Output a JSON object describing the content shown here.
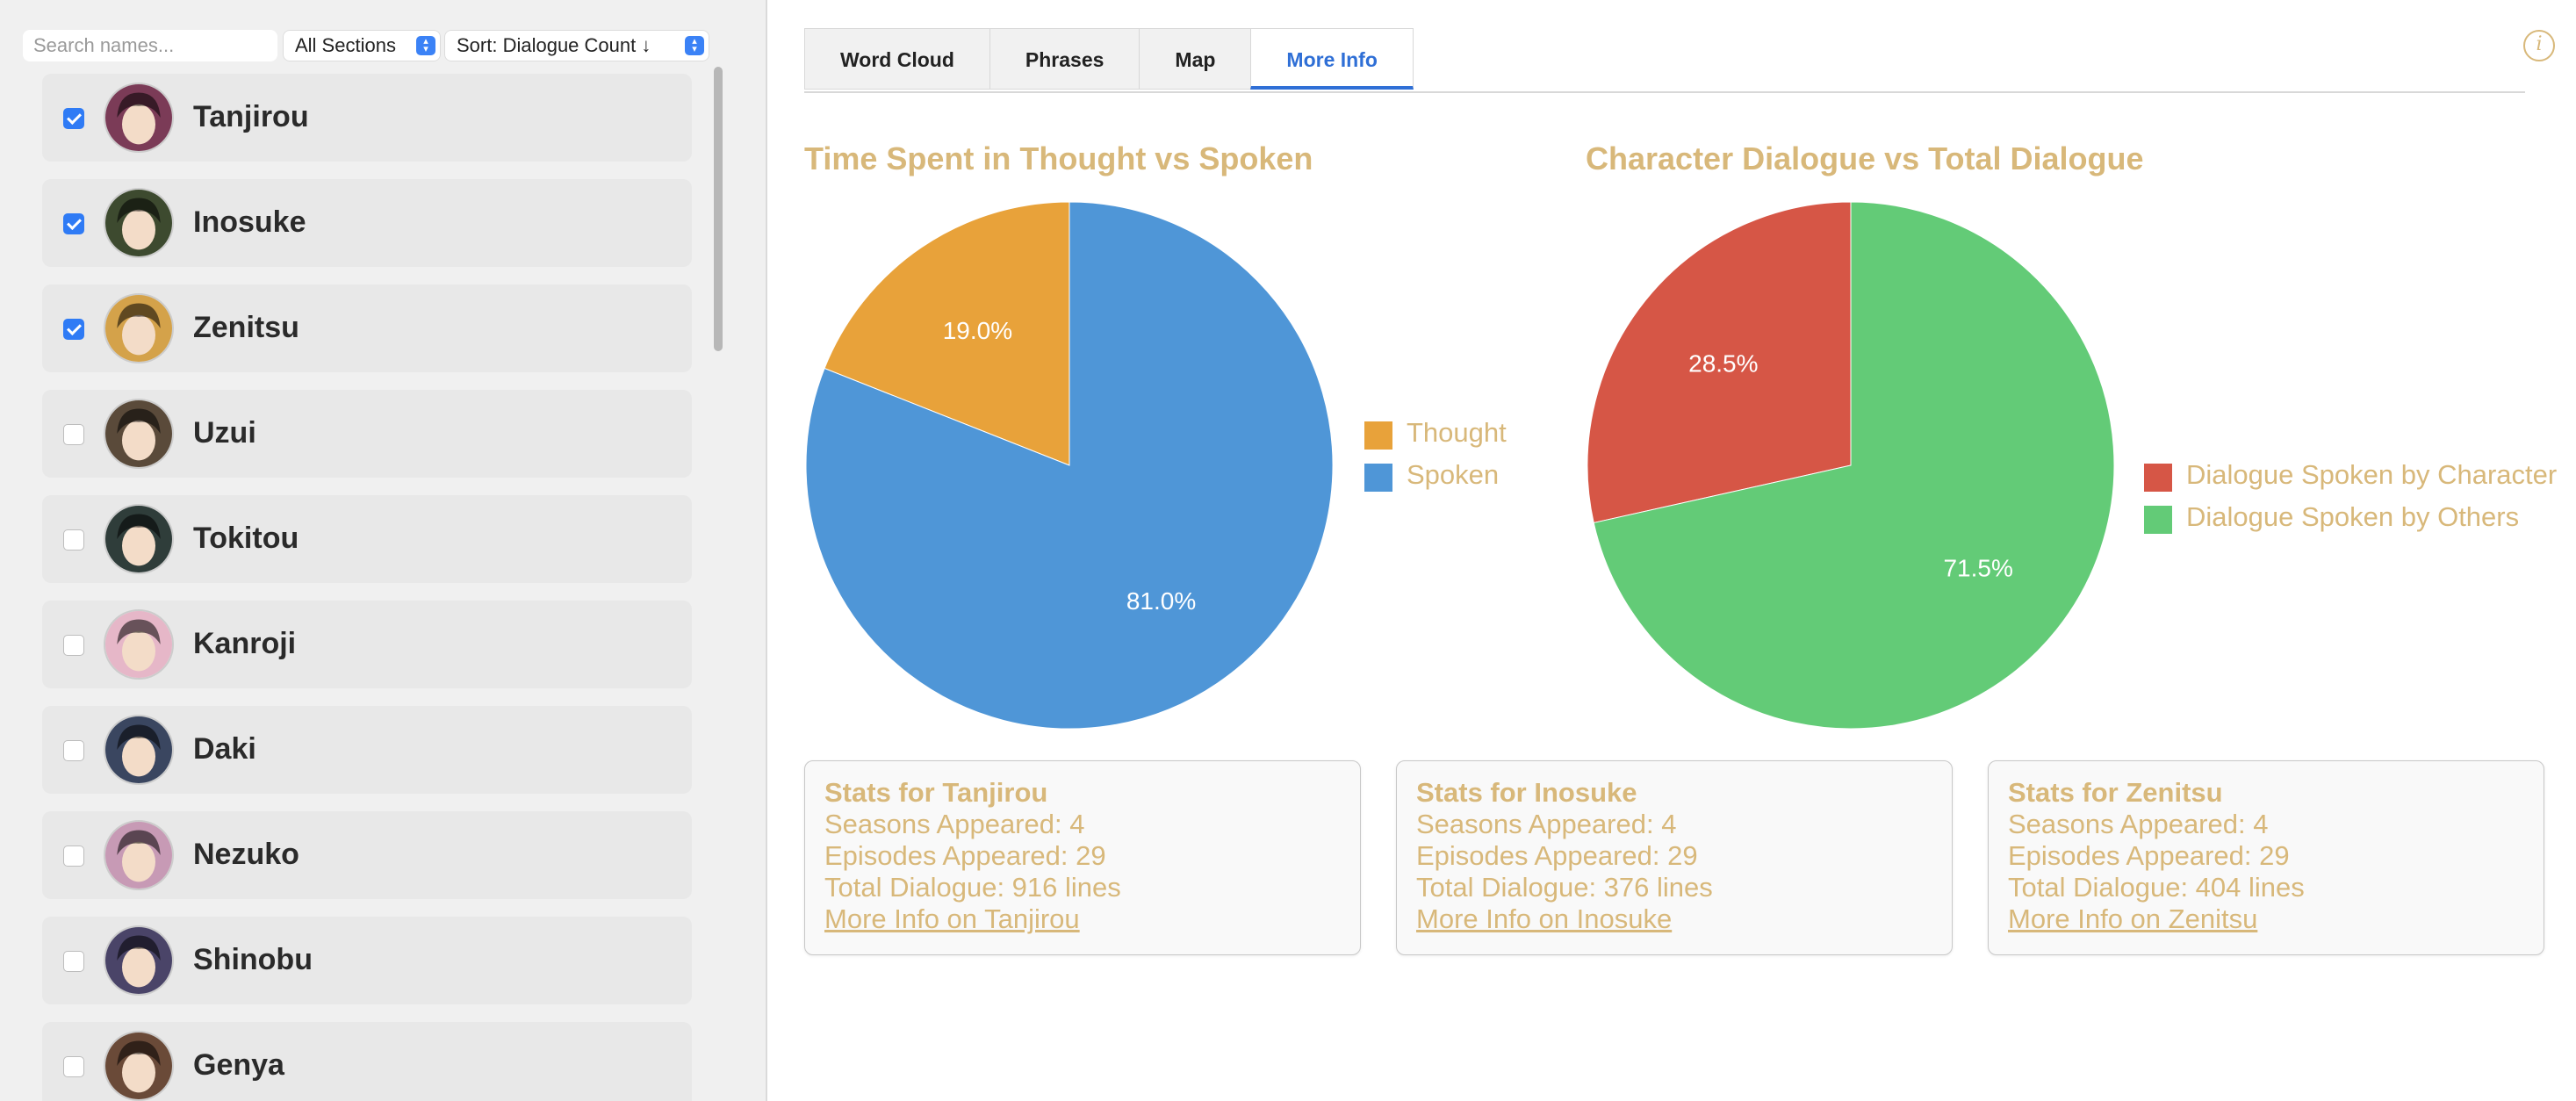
{
  "sidebar": {
    "search_placeholder": "Search names...",
    "sections_select": "All Sections",
    "sort_select": "Sort: Dialogue Count ↓",
    "characters": [
      {
        "name": "Tanjirou",
        "checked": true
      },
      {
        "name": "Inosuke",
        "checked": true
      },
      {
        "name": "Zenitsu",
        "checked": true
      },
      {
        "name": "Uzui",
        "checked": false
      },
      {
        "name": "Tokitou",
        "checked": false
      },
      {
        "name": "Kanroji",
        "checked": false
      },
      {
        "name": "Daki",
        "checked": false
      },
      {
        "name": "Nezuko",
        "checked": false
      },
      {
        "name": "Shinobu",
        "checked": false
      },
      {
        "name": "Genya",
        "checked": false
      }
    ]
  },
  "tabs": [
    {
      "label": "Word Cloud",
      "active": false
    },
    {
      "label": "Phrases",
      "active": false
    },
    {
      "label": "Map",
      "active": false
    },
    {
      "label": "More Info",
      "active": true
    }
  ],
  "info_icon": "i",
  "colors": {
    "accent_text": "#d8b87a",
    "thought": "#e8a23a",
    "spoken": "#4f96d7",
    "character": "#d65646",
    "others": "#63cb77",
    "tab_active": "#2f6fd6"
  },
  "chart_data": [
    {
      "type": "pie",
      "title": "Time Spent in Thought vs Spoken",
      "categories": [
        "Thought",
        "Spoken"
      ],
      "values": [
        19.0,
        81.0
      ],
      "labels": [
        "19.0%",
        "81.0%"
      ],
      "colors": [
        "#e8a23a",
        "#4f96d7"
      ],
      "legend": "right"
    },
    {
      "type": "pie",
      "title": "Character Dialogue vs Total Dialogue",
      "categories": [
        "Dialogue Spoken by Character",
        "Dialogue Spoken by Others"
      ],
      "values": [
        28.5,
        71.5
      ],
      "labels": [
        "28.5%",
        "71.5%"
      ],
      "colors": [
        "#d65646",
        "#63cb77"
      ],
      "legend": "right"
    }
  ],
  "stats": [
    {
      "title": "Stats for Tanjirou",
      "seasons": "Seasons Appeared: 4",
      "episodes": "Episodes Appeared: 29",
      "dialogue": "Total Dialogue: 916 lines",
      "link": "More Info on Tanjirou"
    },
    {
      "title": "Stats for Inosuke",
      "seasons": "Seasons Appeared: 4",
      "episodes": "Episodes Appeared: 29",
      "dialogue": "Total Dialogue: 376 lines",
      "link": "More Info on Inosuke"
    },
    {
      "title": "Stats for Zenitsu",
      "seasons": "Seasons Appeared: 4",
      "episodes": "Episodes Appeared: 29",
      "dialogue": "Total Dialogue: 404 lines",
      "link": "More Info on Zenitsu"
    }
  ]
}
